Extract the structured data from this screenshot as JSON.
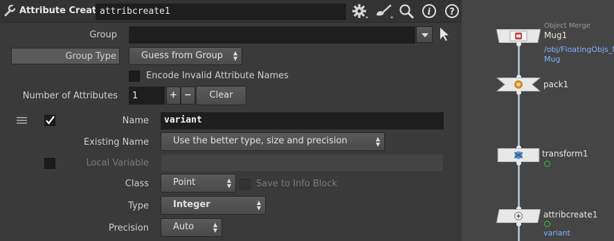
{
  "header": {
    "node_type_label": "Attribute Create",
    "node_name": "attribcreate1",
    "icons": [
      "wrench-icon",
      "gear-icon",
      "brush-icon",
      "search-icon",
      "info-icon",
      "help-icon"
    ]
  },
  "params": {
    "group_label": "Group",
    "group_value": "",
    "group_type_label": "Group Type",
    "group_type_value": "Guess from Group",
    "encode_label": "Encode Invalid Attribute Names",
    "num_attr_label": "Number of Attributes",
    "num_attr_value": "1",
    "plus": "+",
    "minus": "−",
    "clear_label": "Clear",
    "name_label": "Name",
    "name_value": "variant",
    "existing_name_label": "Existing Name",
    "existing_name_value": "Use the better type, size and precision",
    "local_var_label": "Local Variable",
    "local_var_value": "",
    "class_label": "Class",
    "class_value": "Point",
    "save_info_label": "Save to Info Block",
    "type_label": "Type",
    "type_value": "Integer",
    "precision_label": "Precision",
    "precision_value": "Auto"
  },
  "network": {
    "nodes": [
      {
        "name": "Mug1",
        "type_label": "Object Merge",
        "sub": [
          "/obj/FloatingObjs_M",
          "Mug"
        ]
      },
      {
        "name": "pack1"
      },
      {
        "name": "transform1"
      },
      {
        "name": "attribcreate1",
        "sub": [
          "variant"
        ]
      }
    ]
  }
}
